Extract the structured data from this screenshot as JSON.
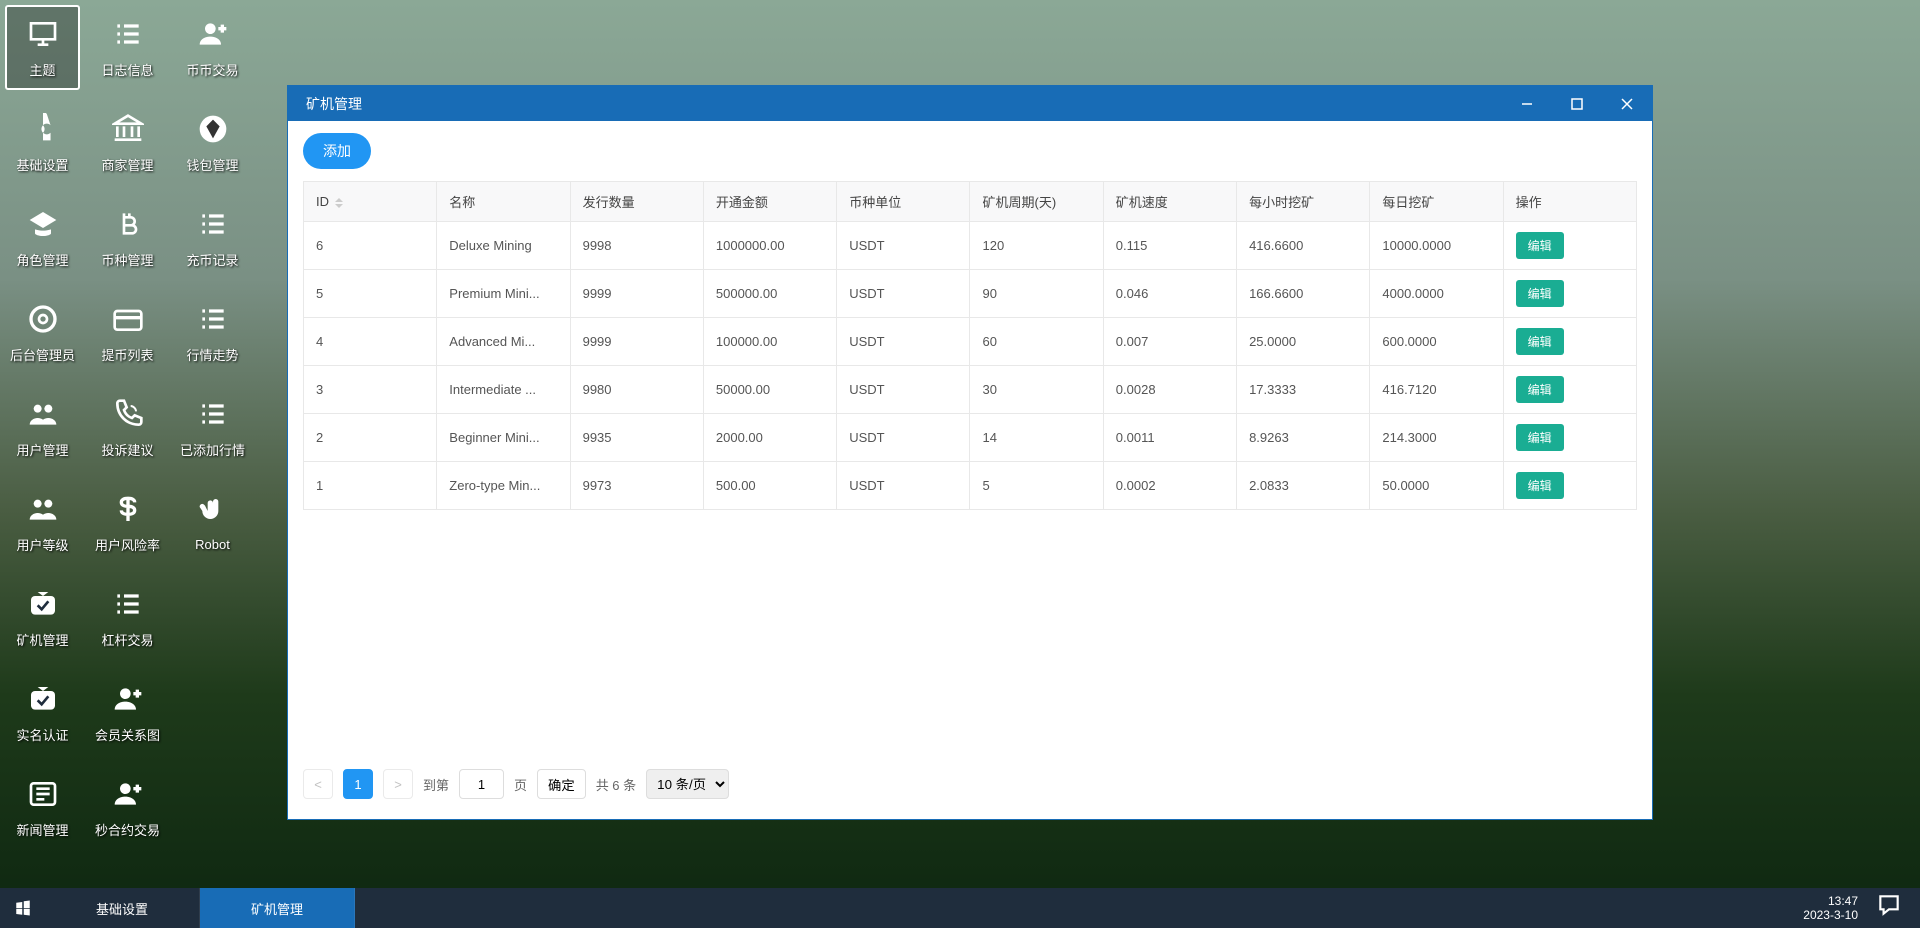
{
  "desktop": {
    "cols": [
      [
        {
          "icon": "monitor",
          "label": "主题",
          "selected": true
        },
        {
          "icon": "wrench",
          "label": "基础设置"
        },
        {
          "icon": "gradcap",
          "label": "角色管理"
        },
        {
          "icon": "userclock",
          "label": "后台管理员"
        },
        {
          "icon": "users",
          "label": "用户管理"
        },
        {
          "icon": "users",
          "label": "用户等级"
        },
        {
          "icon": "checkbox",
          "label": "矿机管理"
        },
        {
          "icon": "checkbox",
          "label": "实名认证"
        },
        {
          "icon": "newspaper",
          "label": "新闻管理"
        }
      ],
      [
        {
          "icon": "list",
          "label": "日志信息"
        },
        {
          "icon": "bank",
          "label": "商家管理"
        },
        {
          "icon": "bitcoin",
          "label": "币种管理"
        },
        {
          "icon": "card",
          "label": "提币列表"
        },
        {
          "icon": "phone",
          "label": "投诉建议"
        },
        {
          "icon": "dollar",
          "label": "用户风险率"
        },
        {
          "icon": "list",
          "label": "杠杆交易"
        },
        {
          "icon": "userplus",
          "label": "会员关系图"
        },
        {
          "icon": "userplus",
          "label": "秒合约交易"
        }
      ],
      [
        {
          "icon": "userplus",
          "label": "币币交易"
        },
        {
          "icon": "diamond",
          "label": "钱包管理"
        },
        {
          "icon": "list",
          "label": "充币记录"
        },
        {
          "icon": "list",
          "label": "行情走势"
        },
        {
          "icon": "list",
          "label": "已添加行情"
        },
        {
          "icon": "hand",
          "label": "Robot"
        }
      ]
    ]
  },
  "window": {
    "title": "矿机管理",
    "add_label": "添加",
    "headers": [
      "ID",
      "名称",
      "发行数量",
      "开通金额",
      "币种单位",
      "矿机周期(天)",
      "矿机速度",
      "每小时挖矿",
      "每日挖矿",
      "操作"
    ],
    "edit_label": "编辑",
    "rows": [
      {
        "id": "6",
        "name": "Deluxe Mining",
        "qty": "9998",
        "amt": "1000000.00",
        "unit": "USDT",
        "cycle": "120",
        "speed": "0.115",
        "hr": "416.6600",
        "day": "10000.0000"
      },
      {
        "id": "5",
        "name": "Premium Mini...",
        "qty": "9999",
        "amt": "500000.00",
        "unit": "USDT",
        "cycle": "90",
        "speed": "0.046",
        "hr": "166.6600",
        "day": "4000.0000"
      },
      {
        "id": "4",
        "name": "Advanced Mi...",
        "qty": "9999",
        "amt": "100000.00",
        "unit": "USDT",
        "cycle": "60",
        "speed": "0.007",
        "hr": "25.0000",
        "day": "600.0000"
      },
      {
        "id": "3",
        "name": "Intermediate ...",
        "qty": "9980",
        "amt": "50000.00",
        "unit": "USDT",
        "cycle": "30",
        "speed": "0.0028",
        "hr": "17.3333",
        "day": "416.7120"
      },
      {
        "id": "2",
        "name": "Beginner Mini...",
        "qty": "9935",
        "amt": "2000.00",
        "unit": "USDT",
        "cycle": "14",
        "speed": "0.0011",
        "hr": "8.9263",
        "day": "214.3000"
      },
      {
        "id": "1",
        "name": "Zero-type Min...",
        "qty": "9973",
        "amt": "500.00",
        "unit": "USDT",
        "cycle": "5",
        "speed": "0.0002",
        "hr": "2.0833",
        "day": "50.0000"
      }
    ],
    "pager": {
      "current": "1",
      "goto_label": "到第",
      "page_label": "页",
      "confirm_label": "确定",
      "total_label": "共 6 条",
      "per_page": "10 条/页",
      "page_value": "1"
    }
  },
  "taskbar": {
    "items": [
      {
        "label": "基础设置",
        "active": false
      },
      {
        "label": "矿机管理",
        "active": true
      }
    ],
    "time": "13:47",
    "date": "2023-3-10"
  }
}
